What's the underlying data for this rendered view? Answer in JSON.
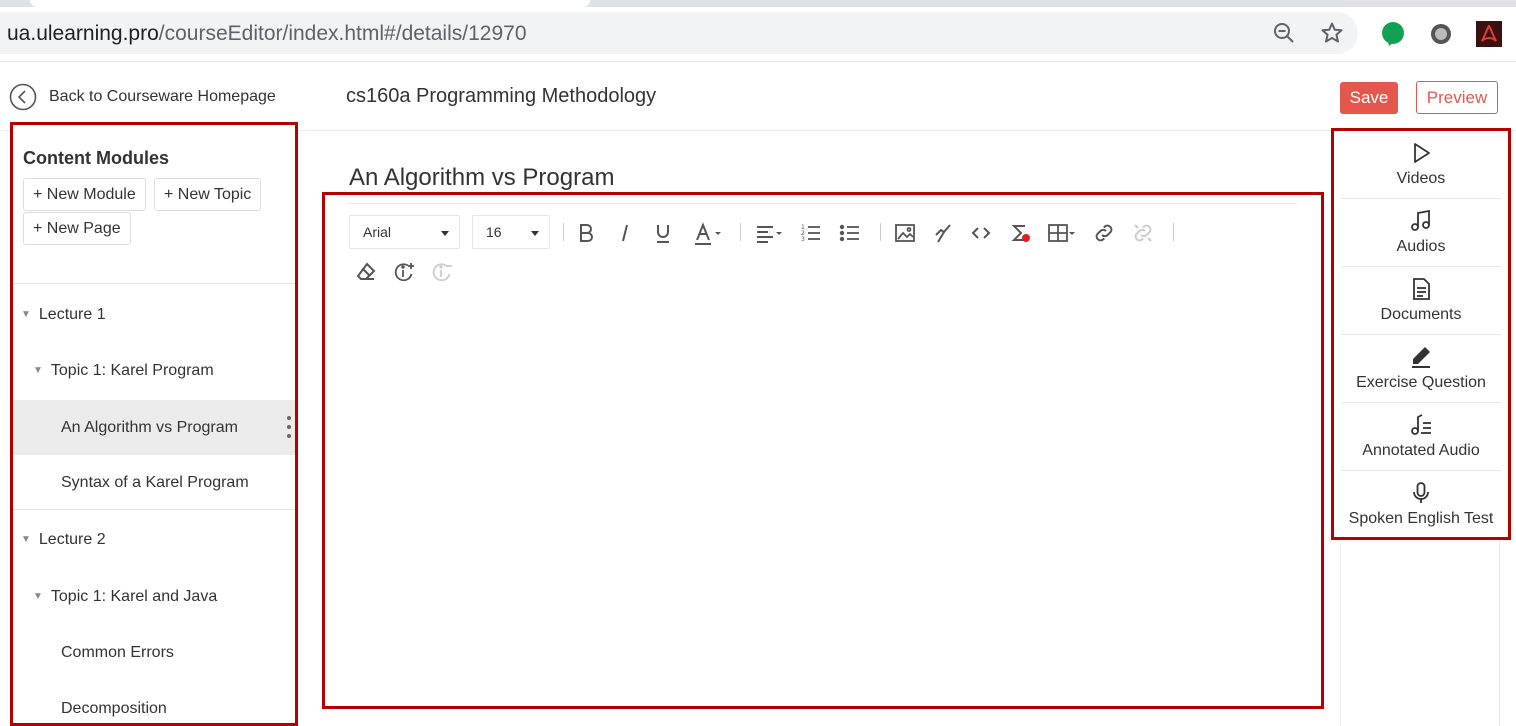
{
  "browser": {
    "url_host": "ua.ulearning.pro",
    "url_path": "/courseEditor/index.html#/details/12970"
  },
  "header": {
    "back_label": "Back to Courseware Homepage",
    "course_title": "cs160a Programming Methodology",
    "save_label": "Save",
    "preview_label": "Preview"
  },
  "sidebar": {
    "title": "Content Modules",
    "new_module": "+ New Module",
    "new_topic": "+ New Topic",
    "new_page": "+ New Page",
    "items": [
      {
        "label": "Lecture 1",
        "level": 0
      },
      {
        "label": "Topic 1: Karel Program",
        "level": 1
      },
      {
        "label": "An Algorithm vs Program",
        "level": 2,
        "selected": true
      },
      {
        "label": "Syntax of a Karel Program",
        "level": 2
      },
      {
        "label": "Lecture 2",
        "level": 0
      },
      {
        "label": "Topic 1: Karel and Java",
        "level": 1
      },
      {
        "label": "Common Errors",
        "level": 2
      },
      {
        "label": "Decomposition",
        "level": 2
      }
    ]
  },
  "editor": {
    "page_title": "An Algorithm vs Program",
    "font_family": "Arial",
    "font_size": "16"
  },
  "resources": {
    "items": [
      {
        "label": "Videos",
        "icon": "play-icon"
      },
      {
        "label": "Audios",
        "icon": "music-note-icon"
      },
      {
        "label": "Documents",
        "icon": "document-icon"
      },
      {
        "label": "Exercise Question",
        "icon": "pencil-icon"
      },
      {
        "label": "Annotated Audio",
        "icon": "annotated-audio-icon"
      },
      {
        "label": "Spoken English Test",
        "icon": "microphone-icon"
      }
    ]
  },
  "colors": {
    "accent": "#e4574c",
    "highlight_border": "#b30000"
  }
}
